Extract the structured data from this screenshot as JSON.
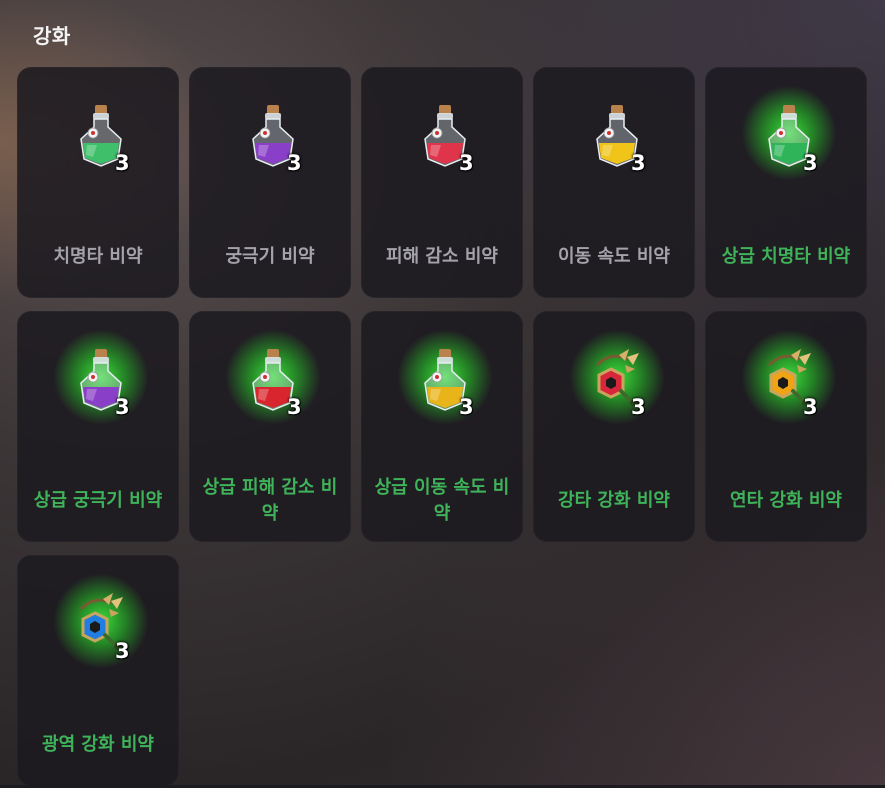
{
  "title": "강화",
  "items": [
    {
      "label": "치명타 비약",
      "count": "3",
      "tier": "normal",
      "kind": "potion",
      "color": "#3fbf6a",
      "icon": "green-potion-icon"
    },
    {
      "label": "궁극기 비약",
      "count": "3",
      "tier": "normal",
      "kind": "potion",
      "color": "#8a3fc8",
      "icon": "purple-potion-icon"
    },
    {
      "label": "피해 감소 비약",
      "count": "3",
      "tier": "normal",
      "kind": "potion",
      "color": "#e0344a",
      "icon": "red-potion-icon"
    },
    {
      "label": "이동 속도 비약",
      "count": "3",
      "tier": "normal",
      "kind": "potion",
      "color": "#f0c419",
      "icon": "yellow-potion-icon"
    },
    {
      "label": "상급 치명타 비약",
      "count": "3",
      "tier": "advanced",
      "kind": "potion",
      "color": "#2fb45a",
      "icon": "green-potion-icon"
    },
    {
      "label": "상급 궁극기 비약",
      "count": "3",
      "tier": "advanced",
      "kind": "potion",
      "color": "#8a3fc8",
      "icon": "purple-potion-icon"
    },
    {
      "label": "상급 피해 감소 비약",
      "count": "3",
      "tier": "advanced",
      "kind": "potion",
      "color": "#d9262e",
      "icon": "red-potion-icon"
    },
    {
      "label": "상급 이동 속도 비약",
      "count": "3",
      "tier": "advanced",
      "kind": "potion",
      "color": "#e9b419",
      "icon": "yellow-potion-icon"
    },
    {
      "label": "강타 강화 비약",
      "count": "3",
      "tier": "advanced",
      "kind": "amulet",
      "color": "#d8263a",
      "icon": "red-amulet-icon"
    },
    {
      "label": "연타 강화 비약",
      "count": "3",
      "tier": "advanced",
      "kind": "amulet",
      "color": "#f0a414",
      "icon": "orange-amulet-icon"
    },
    {
      "label": "광역 강화 비약",
      "count": "3",
      "tier": "advanced",
      "kind": "amulet",
      "color": "#1f7ee0",
      "icon": "blue-amulet-icon"
    }
  ]
}
